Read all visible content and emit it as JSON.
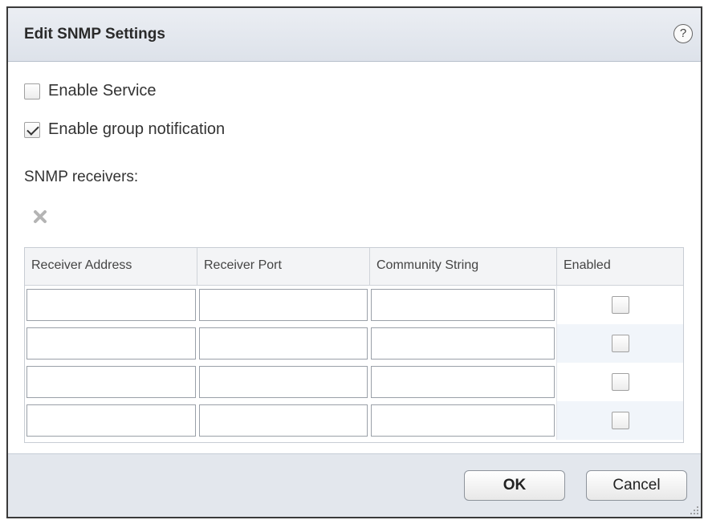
{
  "dialog": {
    "title": "Edit SNMP Settings",
    "help_icon": "help-circle-icon",
    "enable_service": {
      "label": "Enable Service",
      "checked": false
    },
    "enable_group_notification": {
      "label": "Enable group notification",
      "checked": true
    },
    "receivers_label": "SNMP receivers:",
    "remove_icon": "remove-x-icon",
    "table": {
      "columns": [
        "Receiver Address",
        "Receiver Port",
        "Community String",
        "Enabled"
      ],
      "rows": [
        {
          "address": "",
          "port": "",
          "community": "",
          "enabled": false
        },
        {
          "address": "",
          "port": "",
          "community": "",
          "enabled": false
        },
        {
          "address": "",
          "port": "",
          "community": "",
          "enabled": false
        },
        {
          "address": "",
          "port": "",
          "community": "",
          "enabled": false
        }
      ]
    },
    "buttons": {
      "ok": "OK",
      "cancel": "Cancel"
    }
  }
}
